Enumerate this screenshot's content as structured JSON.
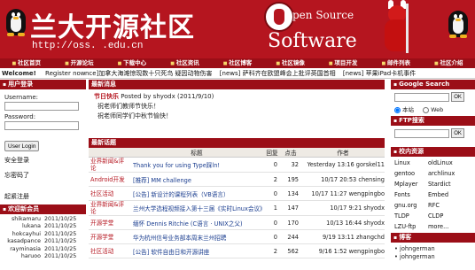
{
  "header": {
    "title": "兰大开源社区",
    "url": "http://oss.    .edu.cn",
    "open_source_line1": "pen Source",
    "open_source_line2": "Software"
  },
  "nav": {
    "items": [
      "社区首页",
      "开源论坛",
      "下载中心",
      "社区资讯",
      "社区博客",
      "社区镜像",
      "项目开发",
      "邮件列表",
      "社区介绍"
    ]
  },
  "ticker": {
    "welcome": "Welcome!",
    "register": "Register now",
    "news": [
      "nce]加拿大海滩惊现数十只死鸟 疑因动物伤害",
      "[news] 萨科齐在欧盟峰会上批评英国首相",
      "[news] 苹果iPad卡机事件"
    ]
  },
  "left": {
    "login_header": "用户登录",
    "username_label": "Username:",
    "password_label": "Password:",
    "login_button": "User Login",
    "safe_login": "安全登录",
    "forgot": "忘密码了",
    "register": "起紧注册",
    "members_header": "欢迎新会员",
    "members": [
      {
        "name": "shikamaru",
        "date": "2011/10/25"
      },
      {
        "name": "lukana",
        "date": "2011/10/25"
      },
      {
        "name": "hokcayhui",
        "date": "2011/10/25"
      },
      {
        "name": "kasadpance",
        "date": "2011/10/25"
      },
      {
        "name": "rayminasia",
        "date": "2011/10/25"
      },
      {
        "name": "haruoo",
        "date": "2011/10/25"
      }
    ]
  },
  "main": {
    "news_header": "最新消息",
    "news_title": "节日快乐",
    "news_meta": "Posted by shyodx (2011/9/10)",
    "news_lines": [
      "祝老师们教师节快乐！",
      "祝老师同学们中秋节愉快！"
    ],
    "topics_header": "最新话题",
    "columns": [
      "",
      "标题",
      "回复",
      "点击",
      "作者"
    ],
    "topics": [
      {
        "cat": "业界新闻&评论",
        "title": "Thank you for using Type踩ln!",
        "replies": "0",
        "clicks": "32",
        "author": "Yesterday 13:16 gorskel11"
      },
      {
        "cat": "Android开发",
        "title": "[推荐] MM challenge",
        "replies": "2",
        "clicks": "195",
        "author": "10/17 20:53 chensing"
      },
      {
        "cat": "社区活动",
        "title": "[公告] 新设计的课程列表（VB语言）",
        "replies": "0",
        "clicks": "134",
        "author": "10/17 11:27 wengpingbo"
      },
      {
        "cat": "业界新闻&评论",
        "title": "兰州大学选程视频接入第十三届《实时Linux会议》现场",
        "replies": "1",
        "clicks": "147",
        "author": "10/17 9:21 shyodx"
      },
      {
        "cat": "开源学堂",
        "title": "缅怀 Dennis Ritchie (C语言 · UNIX之父)",
        "replies": "0",
        "clicks": "170",
        "author": "10/13 16:44 shyodx"
      },
      {
        "cat": "开源学堂",
        "title": "华为杭州信号业务部本周末兰州招聘",
        "replies": "0",
        "clicks": "244",
        "author": "9/19 13:11 zhangchd"
      },
      {
        "cat": "社区活动",
        "title": "[公告] 软件自由日和开源讲座",
        "replies": "2",
        "clicks": "562",
        "author": "9/16 1:52 wengpingbo"
      }
    ]
  },
  "right": {
    "google_header": "Google Search",
    "ok_label": "OK",
    "radio_site": "本站",
    "radio_web": "Web",
    "ftp_header": "FTP搜索",
    "resources_header": "校内资源",
    "resources": [
      "Linux",
      "oldLinux",
      "gentoo",
      "archlinux",
      "Mplayer",
      "Stardict",
      "Fonts",
      "Embed",
      "gnu.org",
      "RFC",
      "TLDP",
      "CLDP",
      "LZU-ftp",
      "more..."
    ],
    "blog_header": "博客",
    "blogs": [
      "johngerman",
      "johngerman"
    ]
  },
  "colors": {
    "banner": "#b5151f",
    "nav": "#9b0e17",
    "link": "#1a3d8f"
  }
}
